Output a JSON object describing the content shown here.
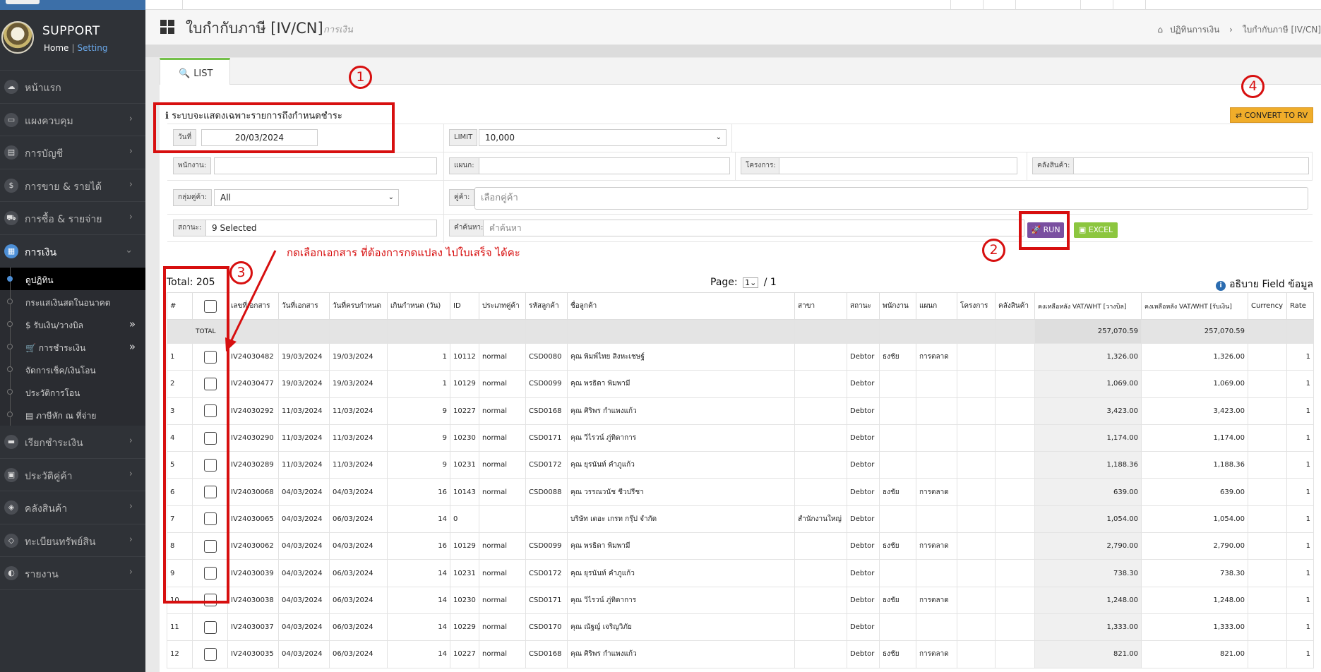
{
  "sidebar": {
    "title": "SUPPORT",
    "home_link": "Home",
    "link_sep": "|",
    "setting_link": "Setting",
    "menu": [
      {
        "label": "หน้าแรก",
        "icon": "cloud-icon"
      },
      {
        "label": "แผงควบคุม",
        "icon": "monitor-icon"
      },
      {
        "label": "การบัญชี",
        "icon": "book-icon"
      },
      {
        "label": "การขาย & รายได้",
        "icon": "dollar-icon"
      },
      {
        "label": "การซื้อ & รายจ่าย",
        "icon": "cart-icon"
      },
      {
        "label": "การเงิน",
        "icon": "calendar-icon"
      }
    ],
    "submenu": [
      {
        "label": "ดูปฏิทิน"
      },
      {
        "label": "กระแสเงินสดในอนาคต"
      },
      {
        "label": "$ รับเงิน/วางบิล",
        "expand": "»"
      },
      {
        "label": "🛒 การชำระเงิน",
        "expand": "»"
      },
      {
        "label": "จัดการเช็ค/เงินโอน"
      },
      {
        "label": "ประวัติการโอน"
      },
      {
        "label": "▤ ภาษีหัก ณ ที่จ่าย"
      }
    ],
    "menu2": [
      {
        "label": "เรียกชำระเงิน",
        "icon": "card-icon"
      },
      {
        "label": "ประวัติคู่ค้า",
        "icon": "contact-icon"
      },
      {
        "label": "คลังสินค้า",
        "icon": "boxes-icon"
      },
      {
        "label": "ทะเบียนทรัพย์สิน",
        "icon": "diamond-icon"
      },
      {
        "label": "รายงาน",
        "icon": "report-icon"
      }
    ],
    "chevron": "›",
    "chevron_down": "⌄"
  },
  "header": {
    "title": "ใบกำกับภาษี [IV/CN]",
    "subtitle": "การเงิน",
    "breadcrumb_home_icon": "⌂",
    "breadcrumb_1": "ปฏิทินการเงิน",
    "breadcrumb_sep": "›",
    "breadcrumb_2": "ใบกำกับภาษี [IV/CN]"
  },
  "tabs": {
    "list_label": "LIST",
    "list_icon": "🔍"
  },
  "filter": {
    "note": "ℹ ระบบจะแสดงเฉพาะรายการถึงกำหนดชำระ",
    "date_label": "วันที่",
    "date_value": "20/03/2024",
    "limit_label": "LIMIT",
    "limit_value": "10,000",
    "employee_label": "พนักงาน:",
    "department_label": "แผนก:",
    "project_label": "โครงการ:",
    "warehouse_label": "คลังสินค้า:",
    "group_label": "กลุ่มคู่ค้า:",
    "group_value": "All",
    "partner_label": "คู่ค้า:",
    "partner_placeholder": "เลือกคู่ค้า",
    "status_label": "สถานะ:",
    "status_value": "9 Selected",
    "search_label": "คำค้นหา:",
    "search_placeholder": "คำค้นหา",
    "run_label": "🚀 RUN",
    "excel_label": "▣ EXCEL",
    "convert_label": "⇄ CONVERT TO RV",
    "caret": "⌄"
  },
  "annotations": {
    "n1": "1",
    "n2": "2",
    "n3": "3",
    "n4": "4",
    "text": "กดเลือกเอกสาร ที่ต้องการกดแปลง ไปใบเสร็จ ได้คะ"
  },
  "summary": {
    "total_label": "Total: 205",
    "page_label": "Page:",
    "page_value": "1",
    "page_sep": "⌄",
    "page_total": "/ 1",
    "explain_icon": "i",
    "explain_label": "อธิบาย Field ข้อมูล"
  },
  "table": {
    "headers": [
      "#",
      "",
      "เลขที่เอกสาร",
      "วันที่เอกสาร",
      "วันที่ครบกำหนด",
      "เกินกำหนด (วัน)",
      "ID",
      "ประเภทคู่ค้า",
      "รหัสลูกค้า",
      "ชื่อลูกค้า",
      "สาขา",
      "สถานะ",
      "พนักงาน",
      "แผนก",
      "โครงการ",
      "คลังสินค้า",
      "คงเหลือหลัง VAT/WHT [วางบิล]",
      "คงเหลือหลัง VAT/WHT [รับเงิน]",
      "Currency",
      "Rate"
    ],
    "total_row": {
      "label": "TOTAL",
      "billed": "257,070.59",
      "received": "257,070.59"
    },
    "rows": [
      [
        "1",
        "IV24030482",
        "19/03/2024",
        "19/03/2024",
        "1",
        "10112",
        "normal",
        "CSD0080",
        "คุณ พิมพ์ไทย สิงหะเชษฐ์",
        "",
        "Debtor",
        "ธงชัย",
        "การตลาด",
        "",
        "",
        "1,326.00",
        "1,326.00",
        "",
        "1"
      ],
      [
        "2",
        "IV24030477",
        "19/03/2024",
        "19/03/2024",
        "1",
        "10129",
        "normal",
        "CSD0099",
        "คุณ พรธิดา พิมพามี",
        "",
        "Debtor",
        "",
        "",
        "",
        "",
        "1,069.00",
        "1,069.00",
        "",
        "1"
      ],
      [
        "3",
        "IV24030292",
        "11/03/2024",
        "11/03/2024",
        "9",
        "10227",
        "normal",
        "CSD0168",
        "คุณ ศิริพร กำแพงแก้ว",
        "",
        "Debtor",
        "",
        "",
        "",
        "",
        "3,423.00",
        "3,423.00",
        "",
        "1"
      ],
      [
        "4",
        "IV24030290",
        "11/03/2024",
        "11/03/2024",
        "9",
        "10230",
        "normal",
        "CSD0171",
        "คุณ วิไรวน์ ภู่ทิดาการ",
        "",
        "Debtor",
        "",
        "",
        "",
        "",
        "1,174.00",
        "1,174.00",
        "",
        "1"
      ],
      [
        "5",
        "IV24030289",
        "11/03/2024",
        "11/03/2024",
        "9",
        "10231",
        "normal",
        "CSD0172",
        "คุณ ยุรนันท์ คำภูแก้ว",
        "",
        "Debtor",
        "",
        "",
        "",
        "",
        "1,188.36",
        "1,188.36",
        "",
        "1"
      ],
      [
        "6",
        "IV24030068",
        "04/03/2024",
        "04/03/2024",
        "16",
        "10143",
        "normal",
        "CSD0088",
        "คุณ วรรณวนัช ชีวปรีชา",
        "",
        "Debtor",
        "ธงชัย",
        "การตลาด",
        "",
        "",
        "639.00",
        "639.00",
        "",
        "1"
      ],
      [
        "7",
        "IV24030065",
        "04/03/2024",
        "06/03/2024",
        "14",
        "0",
        "",
        "",
        "บริษัท เดอะ เกรท กรุ๊ป จำกัด",
        "สำนักงานใหญ่",
        "Debtor",
        "",
        "",
        "",
        "",
        "1,054.00",
        "1,054.00",
        "",
        "1"
      ],
      [
        "8",
        "IV24030062",
        "04/03/2024",
        "04/03/2024",
        "16",
        "10129",
        "normal",
        "CSD0099",
        "คุณ พรธิดา พิมพามี",
        "",
        "Debtor",
        "ธงชัย",
        "การตลาด",
        "",
        "",
        "2,790.00",
        "2,790.00",
        "",
        "1"
      ],
      [
        "9",
        "IV24030039",
        "04/03/2024",
        "06/03/2024",
        "14",
        "10231",
        "normal",
        "CSD0172",
        "คุณ ยุรนันท์ คำภูแก้ว",
        "",
        "Debtor",
        "",
        "",
        "",
        "",
        "738.30",
        "738.30",
        "",
        "1"
      ],
      [
        "10",
        "IV24030038",
        "04/03/2024",
        "06/03/2024",
        "14",
        "10230",
        "normal",
        "CSD0171",
        "คุณ วิไรวน์ ภู่ทิดาการ",
        "",
        "Debtor",
        "ธงชัย",
        "การตลาด",
        "",
        "",
        "1,248.00",
        "1,248.00",
        "",
        "1"
      ],
      [
        "11",
        "IV24030037",
        "04/03/2024",
        "06/03/2024",
        "14",
        "10229",
        "normal",
        "CSD0170",
        "คุณ ณัฐญ์ เจริญวิภัย",
        "",
        "Debtor",
        "",
        "",
        "",
        "",
        "1,333.00",
        "1,333.00",
        "",
        "1"
      ],
      [
        "12",
        "IV24030035",
        "04/03/2024",
        "06/03/2024",
        "14",
        "10227",
        "normal",
        "CSD0168",
        "คุณ ศิริพร กำแพงแก้ว",
        "",
        "Debtor",
        "ธงชัย",
        "การตลาด",
        "",
        "",
        "821.00",
        "821.00",
        "",
        "1"
      ]
    ]
  }
}
